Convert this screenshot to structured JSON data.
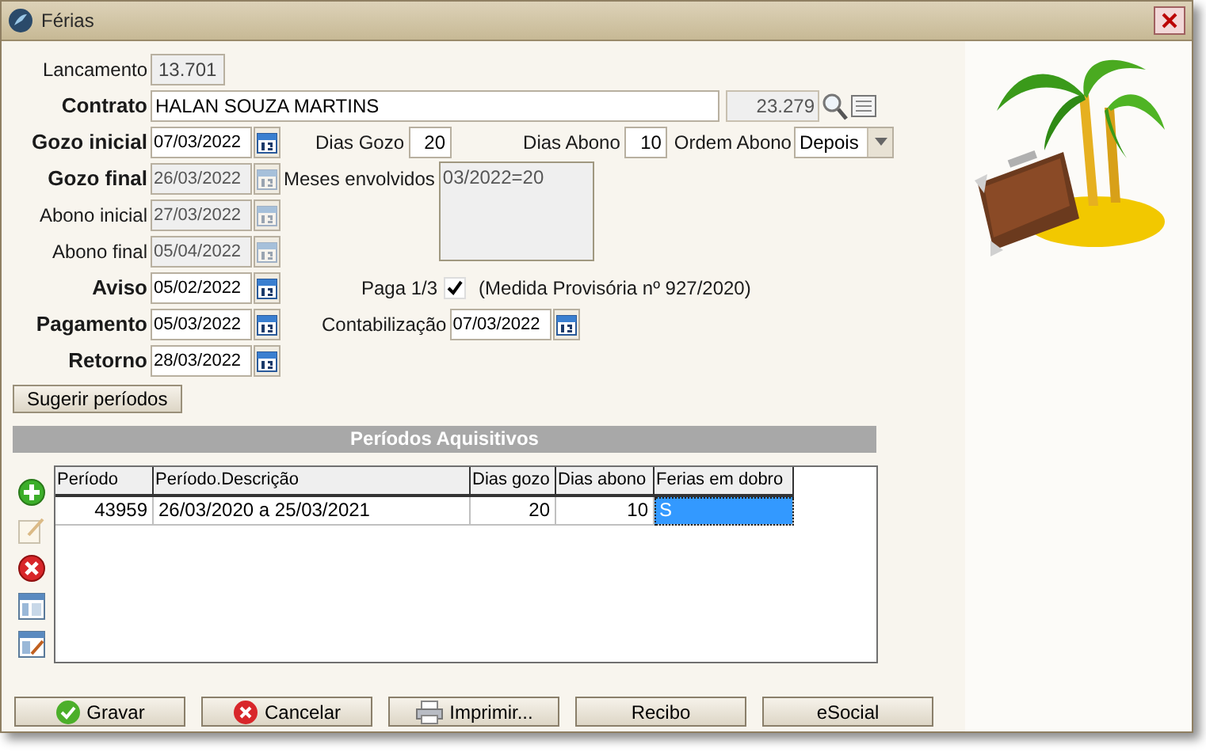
{
  "window": {
    "title": "Férias"
  },
  "lancamento": {
    "label": "Lancamento",
    "value": "13.701"
  },
  "contrato": {
    "label": "Contrato",
    "value": "HALAN SOUZA MARTINS",
    "code": "23.279"
  },
  "dates": [
    {
      "label": "Gozo inicial",
      "value": "07/03/2022",
      "required": true,
      "disabled": false
    },
    {
      "label": "Gozo final",
      "value": "26/03/2022",
      "required": true,
      "disabled": true
    },
    {
      "label": "Abono inicial",
      "value": "27/03/2022",
      "required": false,
      "disabled": true
    },
    {
      "label": "Abono final",
      "value": "05/04/2022",
      "required": false,
      "disabled": true
    },
    {
      "label": "Aviso",
      "value": "05/02/2022",
      "required": true,
      "disabled": false
    },
    {
      "label": "Pagamento",
      "value": "05/03/2022",
      "required": true,
      "disabled": false
    },
    {
      "label": "Retorno",
      "value": "28/03/2022",
      "required": true,
      "disabled": false
    }
  ],
  "dias_gozo": {
    "label": "Dias Gozo",
    "value": "20"
  },
  "dias_abono": {
    "label": "Dias Abono",
    "value": "10"
  },
  "ordem_abono": {
    "label": "Ordem Abono",
    "value": "Depois"
  },
  "meses_envolvidos": {
    "label": "Meses envolvidos",
    "value": "03/2022=20"
  },
  "paga_terco": {
    "label": "Paga 1/3",
    "checked": true,
    "note": "(Medida Provisória nº 927/2020)"
  },
  "contabilizacao": {
    "label": "Contabilização",
    "value": "07/03/2022",
    "disabled": false
  },
  "suggest_button": "Sugerir períodos",
  "periodos": {
    "title": "Períodos Aquisitivos",
    "columns": [
      "Período",
      "Período.Descrição",
      "Dias gozo",
      "Dias abono",
      "Ferias em dobro"
    ],
    "rows": [
      {
        "cells": [
          {
            "text": "43959",
            "selected": false
          },
          {
            "text": "26/03/2020 a 25/03/2021",
            "selected": false
          },
          {
            "text": "20",
            "selected": false
          },
          {
            "text": "10",
            "selected": false
          },
          {
            "text": "S",
            "selected": true
          }
        ]
      }
    ]
  },
  "buttons": [
    "Gravar",
    "Cancelar",
    "Imprimir...",
    "Recibo",
    "eSocial"
  ]
}
